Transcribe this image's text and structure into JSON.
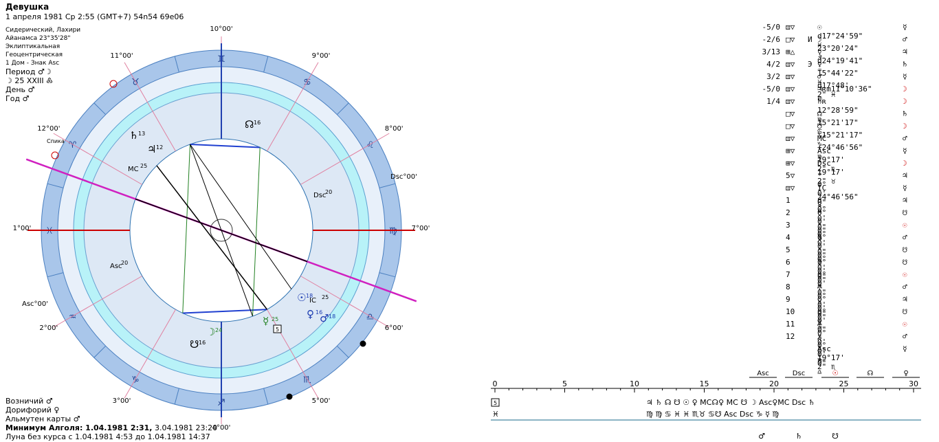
{
  "header": {
    "title": "Девушка",
    "subtitle": "1 апреля 1981  Ср   2:55 (GMT+7) 54n54  69e06"
  },
  "info": {
    "lines": [
      "Сидерический, Лахири",
      "Айанамса 23°35'28\"",
      "Эклиптикальная",
      "Геоцентрическая",
      "1 Дом - Знак Asc"
    ],
    "period": "Период ♂☽",
    "moon_day": "☽  25 XXIII ♸",
    "day": "День ♂",
    "year": "Год ♂"
  },
  "footer": {
    "charioteer": "Возничий  ♂",
    "doryphor": "Дорифорий  ♀",
    "almuten": "Альмутен карты  ♂",
    "algol_label": "Минимум Алголя: 1.04.1981  2:31,",
    "algol_rest": "3.04.1981 23:20",
    "moon_void": "Луна без курса с 1.04.1981  4:53 до 1.04.1981 14:37"
  },
  "chart": {
    "house_labels": [
      "10°00'",
      "11°00'",
      "12°00'",
      "1°00'",
      "2°00'",
      "3°00'",
      "4°00'",
      "5°00'",
      "6°00'",
      "7°00'",
      "8°00'",
      "9°00'"
    ],
    "axis_labels": {
      "asc_outer": "Asc°00'",
      "dsc_outer": "Dsc°00'",
      "asc_inner": "Asc",
      "dsc_inner": "Dsc",
      "asc_deg": "20",
      "dsc_deg": "20",
      "mc": "MC",
      "mc_deg": "25",
      "ic": "IC",
      "ic_deg": "25"
    },
    "spica": "Спика",
    "signs": [
      "♌",
      "♋",
      "♊",
      "♉",
      "♈",
      "♓",
      "♒",
      "♑",
      "♐",
      "♏",
      "♎",
      "♍"
    ],
    "planets": [
      {
        "glyph": "☉",
        "deg": "18"
      },
      {
        "glyph": "♀",
        "deg": "16"
      },
      {
        "glyph": "♂",
        "deg": "18"
      },
      {
        "glyph": "☿",
        "deg": "25"
      },
      {
        "glyph": "☽",
        "deg": "24"
      },
      {
        "glyph": "♄",
        "deg": "13"
      },
      {
        "glyph": "♃",
        "deg": "12"
      },
      {
        "glyph": "☊",
        "deg": "16"
      },
      {
        "glyph": "☋",
        "deg": "16"
      }
    ],
    "box_label": "5"
  },
  "aspect_table": [
    {
      "score": "-5/0",
      "asp": "⚄▽",
      "mark": "",
      "pos": "☉ d17°24'59\" ♓",
      "ruler": "☿"
    },
    {
      "score": "-2/6",
      "asp": "□▽",
      "mark": "И",
      "pos": "☽  23°20'24\" ♐",
      "ruler": "♂"
    },
    {
      "score": "3/13",
      "asp": "⊞△",
      "mark": "",
      "pos": "☿ d24°19'41\" ♒",
      "ruler": "♃"
    },
    {
      "score": "4/2",
      "asp": "⚄▽",
      "mark": "Э",
      "pos": "♀  15°44'22\" ♓",
      "ruler": "♄"
    },
    {
      "score": "3/2",
      "asp": "⚄▽",
      "mark": "",
      "pos": "♂ d17°48' 2\" ♓",
      "ruler": "☿"
    },
    {
      "score": "-5/0",
      "asp": "⚄▽",
      "mark": "",
      "pos": "♃ʀm11°10'36\" ♍",
      "ruler": "☽"
    },
    {
      "score": "1/4",
      "asp": "⚄▽",
      "mark": "",
      "pos": "♄ʀ 12°28'59\" ♍",
      "ruler": "☽"
    },
    {
      "score": "",
      "asp": "□▽",
      "mark": "",
      "pos": "☊  15°21'17\" ♋",
      "ruler": "♄"
    },
    {
      "score": "",
      "asp": "□▽",
      "mark": "",
      "pos": "☋ \\15°21'17\" ♑",
      "ruler": "☽"
    },
    {
      "score": "",
      "asp": "⚄▽",
      "mark": "",
      "pos": "MC +24°46'56\" ♍",
      "ruler": "♂"
    },
    {
      "score": "",
      "asp": "⊞▽",
      "mark": "",
      "pos": "Asc  19°17' 2\" ♏",
      "ruler": "☿"
    },
    {
      "score": "",
      "asp": "⊞▽",
      "mark": "",
      "pos": "Dsc  19°17' 2\" ♉",
      "ruler": "☽"
    },
    {
      "score": "",
      "asp": "5▽",
      "mark": "",
      "pos": "*  0° 0' 0\" ♓",
      "ruler": "♃"
    },
    {
      "score": "",
      "asp": "⚄▽",
      "mark": "",
      "pos": "IC  24°46'56\" ♓",
      "ruler": "☿"
    },
    {
      "score": "",
      "asp": "1",
      "mark": "",
      "pos": "d  0° 0' 0\" ♏",
      "ruler": "♃"
    },
    {
      "score": "",
      "asp": "2",
      "mark": "",
      "pos": "   0° 0' 0\" ♐",
      "ruler": "☋"
    },
    {
      "score": "",
      "asp": "3",
      "mark": "",
      "pos": "*  0° 0' 0\" ♑",
      "ruler": "☉"
    },
    {
      "score": "",
      "asp": "4",
      "mark": "",
      "pos": "   0° 0' 0\" ♒",
      "ruler": "♂"
    },
    {
      "score": "",
      "asp": "5",
      "mark": "",
      "pos": "*  0° 0' 0\" ♓",
      "ruler": "☋"
    },
    {
      "score": "",
      "asp": "6",
      "mark": "",
      "pos": "   0° 0' 0\" ♈",
      "ruler": "☋"
    },
    {
      "score": "",
      "asp": "7",
      "mark": "",
      "pos": "   0° 0' 0\" ♉",
      "ruler": "☉"
    },
    {
      "score": "",
      "asp": "8",
      "mark": "",
      "pos": "*  0° 0' 0\" ♊",
      "ruler": "♂"
    },
    {
      "score": "",
      "asp": "9",
      "mark": "",
      "pos": "   0° 0' 0\" ♋",
      "ruler": "♃"
    },
    {
      "score": "",
      "asp": "10",
      "mark": "",
      "pos": "   0° 0' 0\" ♌",
      "ruler": "☋"
    },
    {
      "score": "",
      "asp": "11",
      "mark": "",
      "pos": "*  0° 0' 0\" ♍",
      "ruler": "☉"
    },
    {
      "score": "",
      "asp": "12",
      "mark": "",
      "pos": "x  0° 0' 0\" ♎",
      "ruler": "♂"
    },
    {
      "score": "",
      "asp": "",
      "mark": "",
      "pos": "Asc  19°17' 2\" ♏",
      "ruler": "☿"
    }
  ],
  "scale": {
    "ticks": [
      "0",
      "5",
      "10",
      "15",
      "20",
      "25",
      "30"
    ],
    "top_marks": [
      "Asc",
      "Dsc",
      "☉",
      "☊",
      "♀"
    ],
    "row1_label": "5",
    "row2_label": "♓",
    "row1": "♃  ♄      ☊ ☋ ☉ ♀ MC☊♀  MC ☋ ☽  Asc♀MC Dsc ♄",
    "row2": "♍  ♍      ♋ ♓ ♓ ♏♉   ♋☋ Asc Dsc ♑ ☿  ♍",
    "bottom": [
      "♂",
      "♄",
      "☋"
    ]
  }
}
